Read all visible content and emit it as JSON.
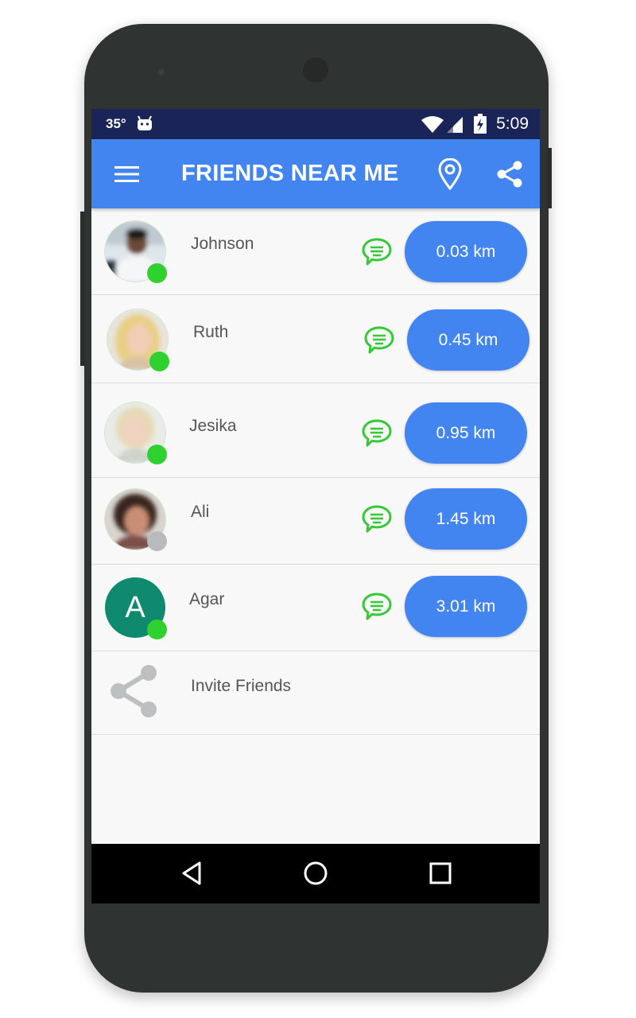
{
  "status_bar": {
    "temperature": "35°",
    "time": "5:09",
    "icons": [
      "android-icon",
      "wifi-icon",
      "signal-icon",
      "battery-charging-icon"
    ]
  },
  "app_bar": {
    "title": "FRIENDS NEAR ME",
    "icons": [
      "menu-icon",
      "location-pin-icon",
      "share-icon"
    ]
  },
  "friends": [
    {
      "name": "Johnson",
      "distance": "0.03 km",
      "online": true
    },
    {
      "name": "Ruth",
      "distance": "0.45 km",
      "online": true
    },
    {
      "name": "Jesika",
      "distance": "0.95 km",
      "online": true
    },
    {
      "name": "Ali",
      "distance": "1.45 km",
      "online": false
    },
    {
      "name": "Agar",
      "distance": "3.01 km",
      "online": true,
      "avatar_letter": "A"
    }
  ],
  "invite": {
    "label": "Invite Friends"
  },
  "colors": {
    "primary": "#4285f1",
    "status_bar": "#1a2456",
    "online": "#2ed12e",
    "offline": "#b8bbbb",
    "chat_icon": "#35c935",
    "letter_avatar": "#0f8a6f"
  },
  "nav_bar": {
    "icons": [
      "back-icon",
      "home-icon",
      "recents-icon"
    ]
  }
}
